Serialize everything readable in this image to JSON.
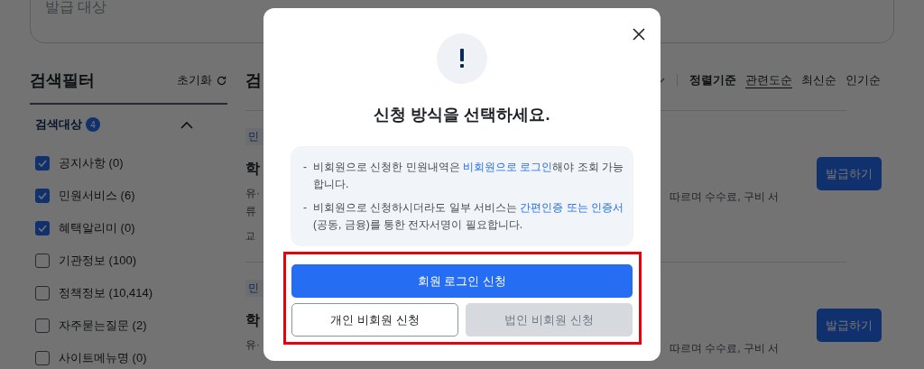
{
  "search_field": {
    "placeholder": "발급 대상"
  },
  "filter": {
    "title": "검색필터",
    "reset": "초기화",
    "section": {
      "title": "검색대상",
      "badge": "4",
      "expanded": true
    },
    "items": [
      {
        "label": "공지사항 (0)",
        "checked": true
      },
      {
        "label": "민원서비스 (6)",
        "checked": true
      },
      {
        "label": "혜택알리미 (0)",
        "checked": true
      },
      {
        "label": "기관정보 (100)",
        "checked": false
      },
      {
        "label": "정책정보 (10,414)",
        "checked": false
      },
      {
        "label": "자주묻는질문 (2)",
        "checked": false
      },
      {
        "label": "사이트메뉴명 (0)",
        "checked": false
      }
    ]
  },
  "results": {
    "heading": "검",
    "sort": {
      "label": "정렬기준",
      "options": [
        {
          "label": "관련도순",
          "selected": true
        },
        {
          "label": "최신순",
          "selected": false
        },
        {
          "label": "인기순",
          "selected": false
        }
      ]
    },
    "items": [
      {
        "tag": "민",
        "title": "학",
        "lines": [
          "유·",
          "류"
        ],
        "meta": "교",
        "description": "따르며 수수료, 구비 서",
        "button": "발급하기"
      },
      {
        "tag": "민",
        "title": "학",
        "lines": [
          "유·"
        ],
        "description": "따르며 수수료, 구비 서",
        "button": "발급하기"
      }
    ]
  },
  "dialog": {
    "title": "신청 방식을 선택하세요.",
    "notes": [
      {
        "marker": "-",
        "parts": [
          {
            "kind": "text",
            "text": "비회원으로 신청한 민원내역은 "
          },
          {
            "kind": "link",
            "text": "비회원으로 로그인"
          },
          {
            "kind": "text",
            "text": "해야 조회 가능 합니다."
          }
        ]
      },
      {
        "marker": "-",
        "parts": [
          {
            "kind": "text",
            "text": "비회원으로 신청하시더라도 일부 서비스는 "
          },
          {
            "kind": "link",
            "text": "간편인증 또는 인증서"
          },
          {
            "kind": "text",
            "text": " (공동, 금융)를 통한 전자서명이 필요합니다."
          }
        ]
      }
    ],
    "buttons": [
      {
        "label": "회원 로그인 신청",
        "kind": "primary",
        "disabled": false
      },
      {
        "label": "개인 비회원 신청",
        "kind": "outline",
        "disabled": false
      },
      {
        "label": "법인 비회원 신청",
        "kind": "outline",
        "disabled": true
      }
    ]
  }
}
